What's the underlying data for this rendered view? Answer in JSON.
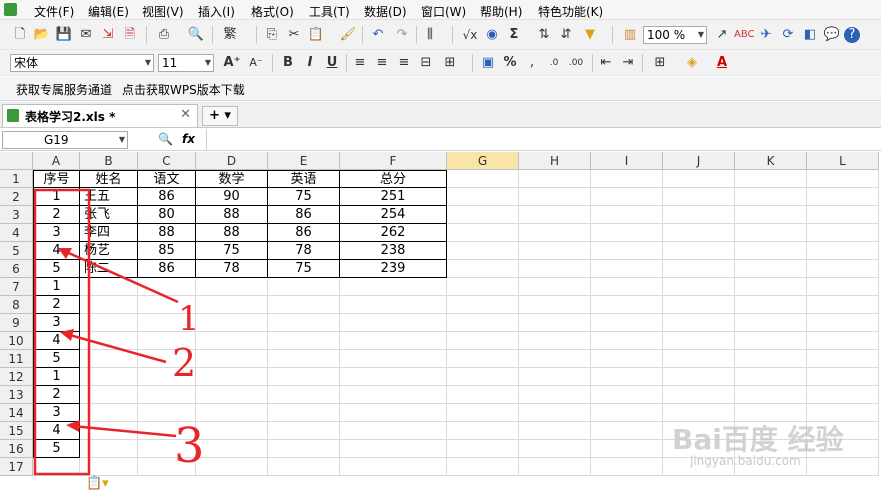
{
  "menu": {
    "items": [
      "文件(F)",
      "编辑(E)",
      "视图(V)",
      "插入(I)",
      "格式(O)",
      "工具(T)",
      "数据(D)",
      "窗口(W)",
      "帮助(H)",
      "特色功能(K)"
    ]
  },
  "toolbar": {
    "zoom": "100 %",
    "font_name": "宋体",
    "font_size": "11",
    "bold": "B",
    "italic": "I",
    "underline": "U",
    "percent": "%",
    "sum": "Σ"
  },
  "promo": {
    "link1": "获取专属服务通道",
    "link2": "点击获取WPS版本下载"
  },
  "tab": {
    "label": "表格学习2.xls *"
  },
  "formula": {
    "name_box": "G19",
    "fx": "fx",
    "value": ""
  },
  "sheet": {
    "columns": [
      "A",
      "B",
      "C",
      "D",
      "E",
      "F",
      "G",
      "H",
      "I",
      "J",
      "K",
      "L"
    ],
    "rows": [
      "1",
      "2",
      "3",
      "4",
      "5",
      "6",
      "7",
      "8",
      "9",
      "10",
      "11",
      "12",
      "13",
      "14",
      "15",
      "16",
      "17"
    ],
    "header_row": [
      "序号",
      "姓名",
      "语文",
      "数学",
      "英语",
      "总分"
    ],
    "data_rows": [
      [
        "1",
        "王五",
        "86",
        "90",
        "75",
        "251"
      ],
      [
        "2",
        "张飞",
        "80",
        "88",
        "86",
        "254"
      ],
      [
        "3",
        "李四",
        "88",
        "88",
        "86",
        "262"
      ],
      [
        "4",
        "杨艺",
        "85",
        "75",
        "78",
        "238"
      ],
      [
        "5",
        "陈二",
        "86",
        "78",
        "75",
        "239"
      ]
    ],
    "col_a_extra": [
      "1",
      "2",
      "3",
      "4",
      "5",
      "1",
      "2",
      "3",
      "4",
      "5"
    ]
  },
  "annotations": {
    "labels": [
      "1",
      "2",
      "3"
    ],
    "color": "#e8262a"
  },
  "watermark": {
    "text": "Bai百度 经验",
    "url": "jingyan.baidu.com"
  }
}
